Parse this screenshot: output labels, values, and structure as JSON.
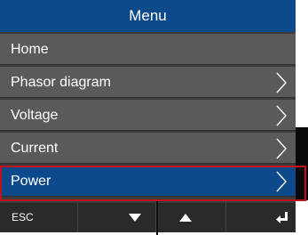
{
  "header": {
    "title": "Menu"
  },
  "menu": {
    "items": [
      {
        "label": "Home",
        "has_submenu": false,
        "selected": false
      },
      {
        "label": "Phasor diagram",
        "has_submenu": true,
        "selected": false
      },
      {
        "label": "Voltage",
        "has_submenu": true,
        "selected": false
      },
      {
        "label": "Current",
        "has_submenu": true,
        "selected": false
      },
      {
        "label": "Power",
        "has_submenu": true,
        "selected": true
      }
    ]
  },
  "softkeys": {
    "esc_label": "ESC",
    "down_icon": "triangle-down-icon",
    "up_icon": "triangle-up-icon",
    "enter_icon": "enter-return-icon"
  },
  "colors": {
    "header_bg": "#0d4a8c",
    "item_bg": "#5a5a5a",
    "selected_bg": "#0d4a8c",
    "highlight_border": "#c0121c"
  }
}
